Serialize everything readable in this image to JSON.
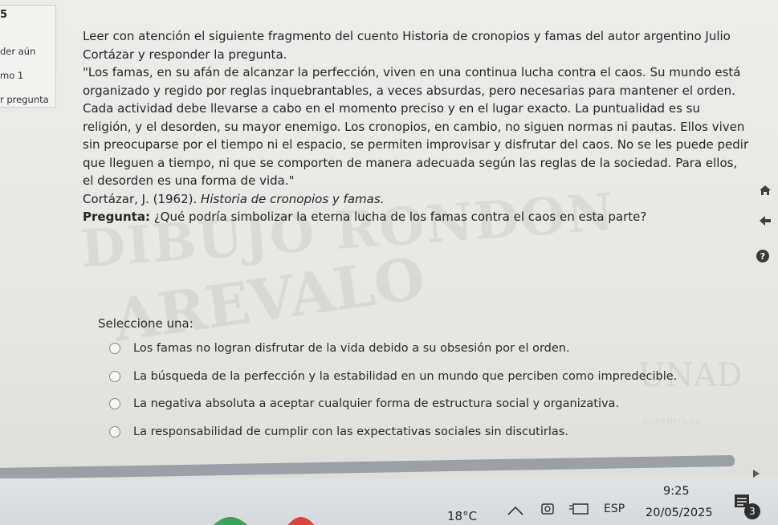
{
  "left_panel": {
    "line1": "der aún",
    "line2": "mo 1",
    "line3": "r pregunta"
  },
  "question": {
    "intro": "Leer con atención el siguiente fragmento del cuento Historia de cronopios y famas del autor argentino Julio Cortázar y responder la pregunta.",
    "quote": "\"Los famas, en su afán de alcanzar la perfección, viven en una continua lucha contra el caos. Su mundo está organizado y regido por reglas inquebrantables, a veces absurdas, pero necesarias para mantener el orden. Cada actividad debe llevarse a cabo en el momento preciso y en el lugar exacto. La puntualidad es su religión, y el desorden, su mayor enemigo. Los cronopios, en cambio, no siguen normas ni pautas. Ellos viven sin preocuparse por el tiempo ni el espacio, se permiten improvisar y disfrutar del caos. No se les puede pedir que lleguen a tiempo, ni que se comporten de manera adecuada según las reglas de la sociedad. Para ellos, el desorden es una forma de vida.\"",
    "citation_prefix": "Cortázar, J. (1962). ",
    "citation_title": "Historia de cronopios y famas.",
    "prompt_label": "Pregunta:",
    "prompt_text": " ¿Qué podría simbolizar la eterna lucha de los famas contra el caos en esta parte?"
  },
  "answer": {
    "select_label": "Seleccione una:",
    "options": [
      "Los famas no logran disfrutar de la vida debido a su obsesión por el orden.",
      "La búsqueda de la perfección y la estabilidad en un mundo que perciben como impredecible.",
      "La negativa absoluta a aceptar cualquier forma de estructura social y organizativa.",
      "La responsabilidad de cumplir con las expectativas sociales sin discutirlas."
    ]
  },
  "watermark": {
    "line1": "DIBUJO RONDON",
    "line2": "AREVALO",
    "line3": "UNAD",
    "line4": "ACREDITADA"
  },
  "taskbar": {
    "temperature": "18°C",
    "language": "ESP",
    "time": "9:25",
    "date": "20/05/2025",
    "notification_count": "3"
  },
  "colors": {
    "nav_icon": "#3f3f3f",
    "help_icon": "#3b3b3b",
    "taskbar_bg": "#dadee1"
  }
}
